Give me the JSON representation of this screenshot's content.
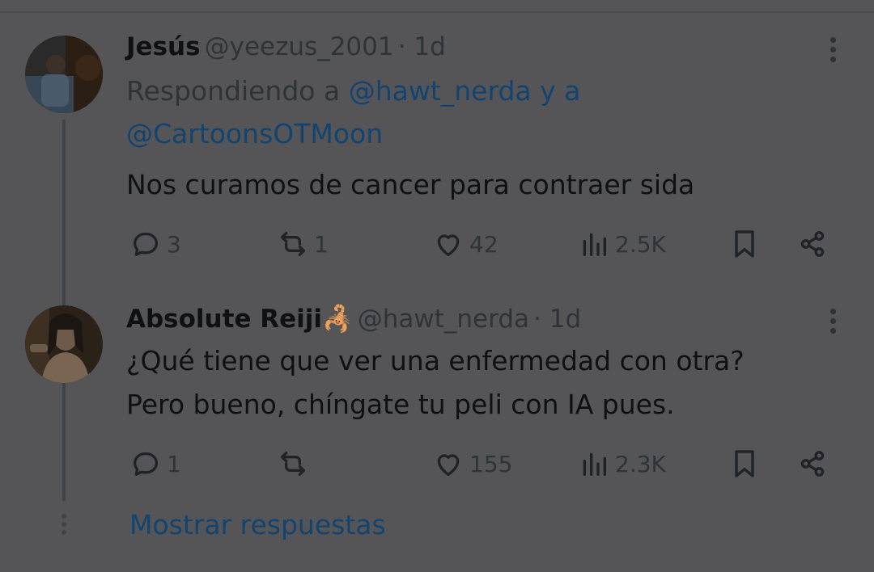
{
  "tweets": [
    {
      "name": "Jesús",
      "handle": "@yeezus_2001",
      "time": "· 1d",
      "reply_prefix": "Respondiendo a",
      "reply_mention_1": "@hawt_nerda",
      "reply_joiner": "y a",
      "reply_mention_2": "@CartoonsOTMoon",
      "text": "Nos curamos de cancer para contraer sida",
      "replies": "3",
      "retweets": "1",
      "likes": "42",
      "views": "2.5K"
    },
    {
      "name": "Absolute Reiji",
      "name_emoji": "🦂",
      "handle": "@hawt_nerda",
      "time": "· 1d",
      "text_line_1": "¿Qué tiene que ver una enfermedad con otra?",
      "text_line_2": "Pero bueno, chíngate tu peli con IA pues.",
      "replies": "1",
      "retweets": "",
      "likes": "155",
      "views": "2.3K"
    }
  ],
  "show_replies_label": "Mostrar respuestas",
  "icons": [
    "reply-icon",
    "retweet-icon",
    "like-icon",
    "views-icon",
    "bookmark-icon",
    "share-icon",
    "more-icon"
  ],
  "colors": {
    "background": "#555558",
    "text": "#0e1013",
    "muted": "#2e3338",
    "link": "#114470"
  }
}
